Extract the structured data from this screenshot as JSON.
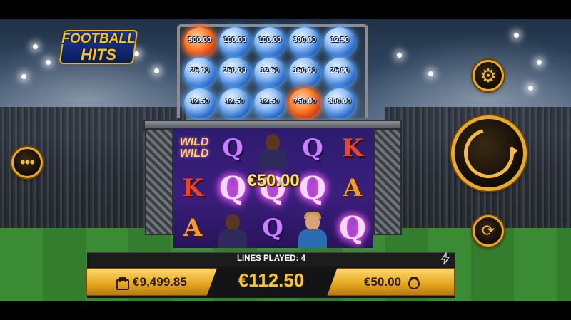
{
  "game": {
    "logo_line1": "FOOTBALL",
    "logo_line2": "HITS"
  },
  "top_grid": {
    "balls": [
      {
        "value": "500.00",
        "type": "fire"
      },
      {
        "value": "100.00",
        "type": "ice"
      },
      {
        "value": "100.00",
        "type": "ice"
      },
      {
        "value": "300.00",
        "type": "ice"
      },
      {
        "value": "12.50",
        "type": "ice"
      },
      {
        "value": "25.00",
        "type": "ice"
      },
      {
        "value": "250.00",
        "type": "ice"
      },
      {
        "value": "12.50",
        "type": "ice"
      },
      {
        "value": "150.00",
        "type": "ice"
      },
      {
        "value": "25.00",
        "type": "ice"
      },
      {
        "value": "12.50",
        "type": "ice"
      },
      {
        "value": "12.50",
        "type": "ice"
      },
      {
        "value": "12.50",
        "type": "ice"
      },
      {
        "value": "750.00",
        "type": "fire"
      },
      {
        "value": "300.00",
        "type": "ice"
      }
    ]
  },
  "reels": {
    "wild_line1": "WILD",
    "wild_line2": "WILD",
    "row1": [
      "Q",
      "Q",
      "K"
    ],
    "row2": [
      "Q",
      "Q",
      "Q",
      "A"
    ],
    "row2_k": "K",
    "row3": [
      "A",
      "Q",
      "Q"
    ],
    "win_amount": "€50.00"
  },
  "status": {
    "lines_played": "LINES PLAYED: 4"
  },
  "footer": {
    "balance": "€9,499.85",
    "total_win": "€112.50",
    "bet": "€50.00"
  },
  "controls": {
    "menu_glyph": "•••",
    "settings_glyph": "⚙",
    "autoplay_glyph": "⟳"
  },
  "colors": {
    "accent_gold": "#e7a92a",
    "win_text": "#fde36a"
  }
}
